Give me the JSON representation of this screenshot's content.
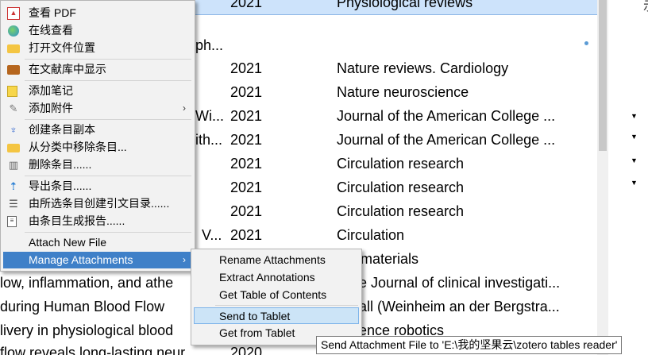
{
  "list": {
    "rows": [
      {
        "title": "",
        "year": "2021",
        "pub": "Physiological reviews",
        "selected": true
      },
      {
        "title": "ph...",
        "year": "",
        "pub": ""
      },
      {
        "title": "",
        "year": "2021",
        "pub": "Nature reviews. Cardiology"
      },
      {
        "title": "",
        "year": "2021",
        "pub": "Nature neuroscience"
      },
      {
        "title": "Wi...",
        "year": "2021",
        "pub": "Journal of the American College ..."
      },
      {
        "title": "ith...",
        "year": "2021",
        "pub": "Journal of the American College ..."
      },
      {
        "title": "",
        "year": "2021",
        "pub": "Circulation research"
      },
      {
        "title": "",
        "year": "2021",
        "pub": "Circulation research"
      },
      {
        "title": "",
        "year": "2021",
        "pub": "Circulation research"
      },
      {
        "title": "V...",
        "year": "2021",
        "pub": "Circulation"
      },
      {
        "title": "",
        "year": "",
        "pub": "materials"
      },
      {
        "title": "low, inflammation, and athe",
        "year": "",
        "pub": "e Journal of clinical investigati..."
      },
      {
        "title": " during Human Blood Flow",
        "year": "",
        "pub": "all (Weinheim an der Bergstra..."
      },
      {
        "title": "livery in physiological blood",
        "year": "",
        "pub": "ence robotics"
      },
      {
        "title": " flow reveals long-lasting neur...",
        "year": "2020",
        "pub": ""
      }
    ]
  },
  "right_pane": {
    "text": "示"
  },
  "context_menu": {
    "items": [
      {
        "label": "查看 PDF",
        "icon": "pdf-icon"
      },
      {
        "label": "在线查看",
        "icon": "globe-icon"
      },
      {
        "label": "打开文件位置",
        "icon": "folder-icon"
      },
      {
        "label": "在文献库中显示",
        "icon": "library-icon"
      },
      {
        "label": "添加笔记",
        "icon": "note-icon"
      },
      {
        "label": "添加附件",
        "icon": "paperclip-icon",
        "submenu": true
      },
      {
        "label": "创建条目副本",
        "icon": "duplicate-icon"
      },
      {
        "label": "从分类中移除条目...",
        "icon": "remove-from-collection-icon"
      },
      {
        "label": "删除条目......",
        "icon": "trash-icon"
      },
      {
        "label": "导出条目......",
        "icon": "export-icon"
      },
      {
        "label": "由所选条目创建引文目录......",
        "icon": "bibliography-icon"
      },
      {
        "label": "由条目生成报告......",
        "icon": "report-icon"
      },
      {
        "label": "Attach New File",
        "icon": ""
      },
      {
        "label": "Manage Attachments",
        "icon": "",
        "submenu": true,
        "highlighted": true
      }
    ]
  },
  "submenu": {
    "items": [
      {
        "label": "Rename Attachments"
      },
      {
        "label": "Extract Annotations"
      },
      {
        "label": "Get Table of Contents"
      },
      {
        "label": "Send to Tablet",
        "highlighted": true
      },
      {
        "label": "Get from Tablet"
      }
    ]
  },
  "tooltip": {
    "text": "Send Attachment File to 'E:\\我的坚果云\\zotero tables reader'"
  },
  "colors": {
    "menu_highlight": "#3f80c8",
    "submenu_highlight": "#cce4f7",
    "row_selected": "#cde3fb"
  }
}
